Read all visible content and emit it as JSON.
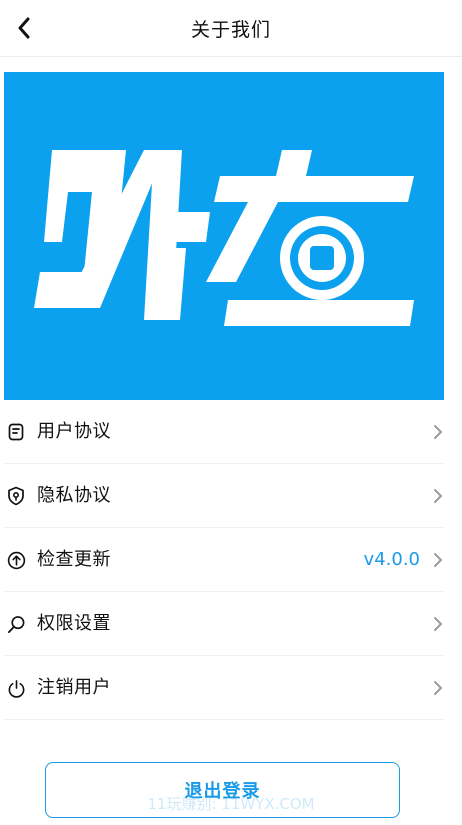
{
  "header": {
    "title": "关于我们",
    "back_icon": "chevron-left-icon"
  },
  "banner": {
    "background": "#0ba1ee",
    "logo_text": "财查",
    "logo_color": "#ffffff"
  },
  "menu": {
    "items": [
      {
        "label": "用户协议",
        "icon": "document-icon",
        "value": ""
      },
      {
        "label": "隐私协议",
        "icon": "shield-icon",
        "value": ""
      },
      {
        "label": "检查更新",
        "icon": "arrow-up-circle-icon",
        "value": "v4.0.0"
      },
      {
        "label": "权限设置",
        "icon": "search-icon",
        "value": ""
      },
      {
        "label": "注销用户",
        "icon": "power-icon",
        "value": ""
      }
    ],
    "chevron_icon": "chevron-right-icon"
  },
  "logout": {
    "label": "退出登录"
  },
  "watermark": {
    "text": "11玩赚别: 11WYX.COM"
  },
  "colors": {
    "accent": "#1a9be8",
    "banner": "#0ba1ee",
    "text": "#111111",
    "chevron": "#9a9a9a"
  }
}
